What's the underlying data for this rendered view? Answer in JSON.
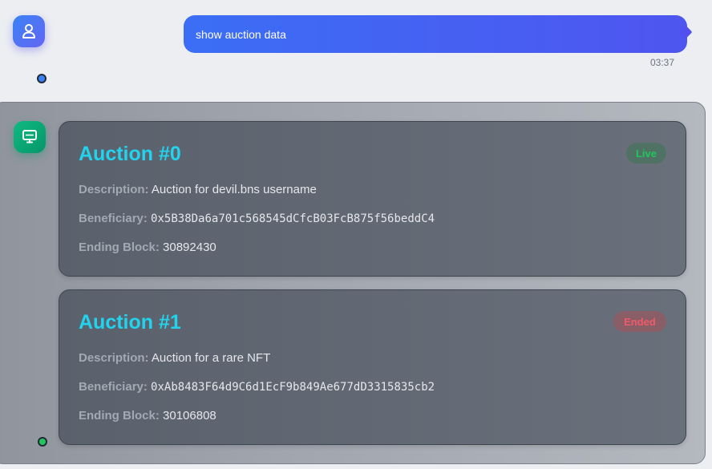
{
  "user_message": {
    "text": "show auction data",
    "time": "03:37"
  },
  "icons": {
    "user": "user-icon",
    "bot": "monitor-icon"
  },
  "colors": {
    "accent_blue": "#3b6ef5",
    "accent_indigo": "#4f55f0",
    "title_cyan": "#22d3ee",
    "live_green": "#22c55e",
    "ended_red": "#f05a68"
  },
  "auctions": [
    {
      "title": "Auction #0",
      "status": "Live",
      "description_label": "Description:",
      "description": "Auction for devil.bns username",
      "beneficiary_label": "Beneficiary:",
      "beneficiary": "0x5B38Da6a701c568545dCfcB03FcB875f56beddC4",
      "ending_label": "Ending Block:",
      "ending_block": "30892430"
    },
    {
      "title": "Auction #1",
      "status": "Ended",
      "description_label": "Description:",
      "description": "Auction for a rare NFT",
      "beneficiary_label": "Beneficiary:",
      "beneficiary": "0xAb8483F64d9C6d1EcF9b849Ae677dD3315835cb2",
      "ending_label": "Ending Block:",
      "ending_block": "30106808"
    }
  ]
}
